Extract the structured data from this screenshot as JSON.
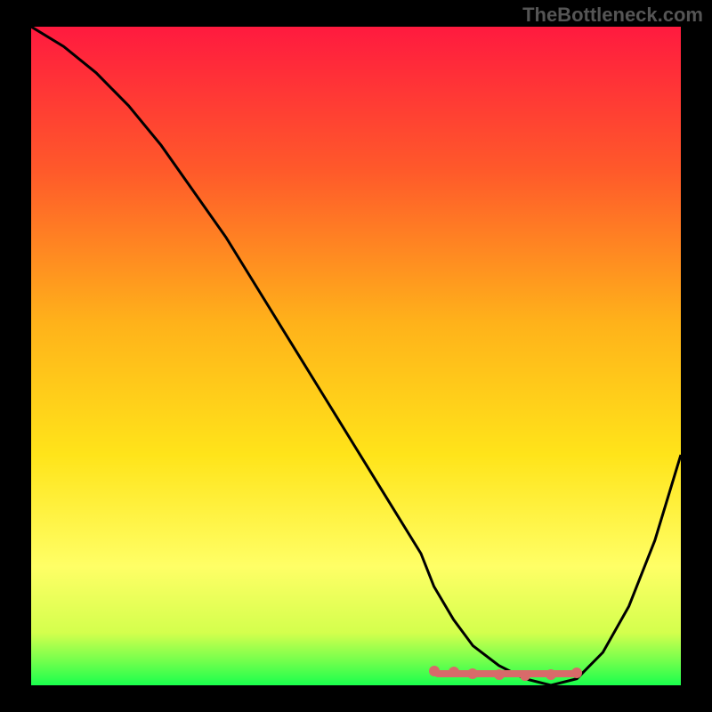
{
  "watermark": "TheBottleneck.com",
  "colors": {
    "background": "#000000",
    "gradient_top": "#ff1a3f",
    "gradient_mid_upper": "#ff7a2a",
    "gradient_mid": "#ffd21a",
    "gradient_lower": "#ffff66",
    "gradient_bottom": "#1aff4d",
    "curve": "#000000",
    "markers": "#d86a6a"
  },
  "chart_data": {
    "type": "line",
    "title": "",
    "xlabel": "",
    "ylabel": "",
    "xlim": [
      0,
      100
    ],
    "ylim": [
      0,
      100
    ],
    "series": [
      {
        "name": "bottleneck-curve",
        "x": [
          0,
          5,
          10,
          15,
          20,
          25,
          30,
          35,
          40,
          45,
          50,
          55,
          60,
          62,
          65,
          68,
          72,
          76,
          80,
          84,
          88,
          92,
          96,
          100
        ],
        "values": [
          100,
          97,
          93,
          88,
          82,
          75,
          68,
          60,
          52,
          44,
          36,
          28,
          20,
          15,
          10,
          6,
          3,
          1,
          0,
          1,
          5,
          12,
          22,
          35
        ]
      }
    ],
    "markers": {
      "name": "bottom-band",
      "x": [
        62,
        65,
        68,
        72,
        76,
        80,
        84
      ],
      "values": [
        2.2,
        2.0,
        1.8,
        1.6,
        1.5,
        1.6,
        1.9
      ]
    },
    "annotations": []
  }
}
